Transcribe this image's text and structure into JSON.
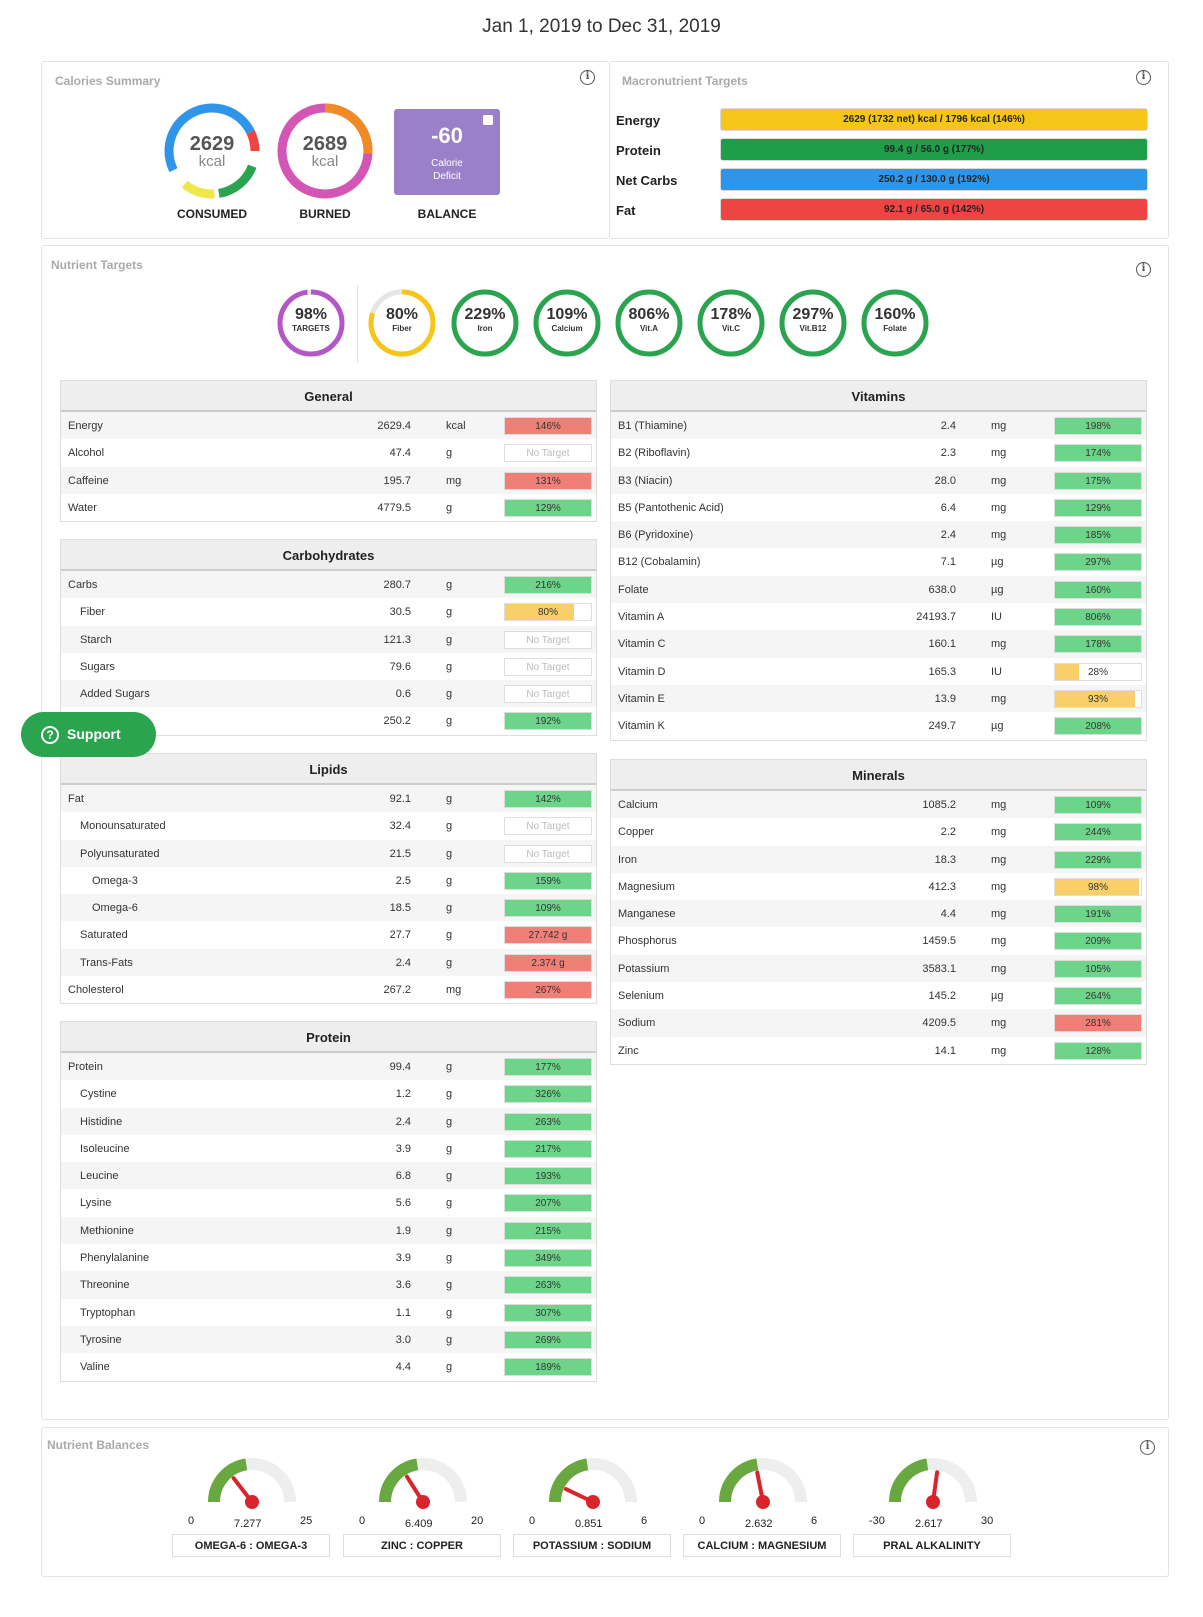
{
  "title": "Jan 1, 2019 to Dec 31, 2019",
  "calories_summary": {
    "title": "Calories Summary",
    "consumed": {
      "value": "2629",
      "unit": "kcal",
      "label": "CONSUMED"
    },
    "burned": {
      "value": "2689",
      "unit": "kcal",
      "label": "BURNED"
    },
    "balance": {
      "value": "-60",
      "sub1": "Calorie",
      "sub2": "Deficit",
      "label": "BALANCE"
    }
  },
  "macros": {
    "title": "Macronutrient Targets",
    "rows": [
      {
        "label": "Energy",
        "text": "2629 (1732 net) kcal / 1796 kcal (146%)",
        "color": "#f5c518"
      },
      {
        "label": "Protein",
        "text": "99.4 g / 56.0 g (177%)",
        "color": "#1f9e4a"
      },
      {
        "label": "Net Carbs",
        "text": "250.2 g / 130.0 g (192%)",
        "color": "#2f95e8"
      },
      {
        "label": "Fat",
        "text": "92.1 g / 65.0 g (142%)",
        "color": "#ef4444"
      }
    ]
  },
  "nutrient_targets": {
    "title": "Nutrient Targets",
    "circles": [
      {
        "pct": "98%",
        "name": "TARGETS",
        "color": "#b455c8",
        "fill": 0.98
      },
      {
        "pct": "80%",
        "name": "Fiber",
        "color": "#f5c518",
        "fill": 0.8
      },
      {
        "pct": "229%",
        "name": "Iron",
        "color": "#2aa44f",
        "fill": 1
      },
      {
        "pct": "109%",
        "name": "Calcium",
        "color": "#2aa44f",
        "fill": 1
      },
      {
        "pct": "806%",
        "name": "Vit.A",
        "color": "#2aa44f",
        "fill": 1
      },
      {
        "pct": "178%",
        "name": "Vit.C",
        "color": "#2aa44f",
        "fill": 1
      },
      {
        "pct": "297%",
        "name": "Vit.B12",
        "color": "#2aa44f",
        "fill": 1
      },
      {
        "pct": "160%",
        "name": "Folate",
        "color": "#2aa44f",
        "fill": 1
      }
    ]
  },
  "tables": {
    "general": {
      "title": "General",
      "rows": [
        [
          "Energy",
          "2629.4",
          "kcal",
          "146%",
          "r",
          1,
          0
        ],
        [
          "Alcohol",
          "47.4",
          "g",
          "No Target",
          "n",
          0,
          0
        ],
        [
          "Caffeine",
          "195.7",
          "mg",
          "131%",
          "r",
          1,
          0
        ],
        [
          "Water",
          "4779.5",
          "g",
          "129%",
          "g",
          1,
          0
        ]
      ]
    },
    "carbs": {
      "title": "Carbohydrates",
      "rows": [
        [
          "Carbs",
          "280.7",
          "g",
          "216%",
          "g",
          1,
          0
        ],
        [
          "Fiber",
          "30.5",
          "g",
          "80%",
          "y",
          0.8,
          1
        ],
        [
          "Starch",
          "121.3",
          "g",
          "No Target",
          "n",
          0,
          1
        ],
        [
          "Sugars",
          "79.6",
          "g",
          "No Target",
          "n",
          0,
          1
        ],
        [
          "Added Sugars",
          "0.6",
          "g",
          "No Target",
          "n",
          0,
          1
        ],
        [
          "",
          "250.2",
          "g",
          "192%",
          "g",
          1,
          1
        ]
      ]
    },
    "lipids": {
      "title": "Lipids",
      "rows": [
        [
          "Fat",
          "92.1",
          "g",
          "142%",
          "g",
          1,
          0
        ],
        [
          "Monounsaturated",
          "32.4",
          "g",
          "No Target",
          "n",
          0,
          1
        ],
        [
          "Polyunsaturated",
          "21.5",
          "g",
          "No Target",
          "n",
          0,
          1
        ],
        [
          "Omega-3",
          "2.5",
          "g",
          "159%",
          "g",
          1,
          2
        ],
        [
          "Omega-6",
          "18.5",
          "g",
          "109%",
          "g",
          1,
          2
        ],
        [
          "Saturated",
          "27.7",
          "g",
          "27.742 g",
          "r",
          1,
          1
        ],
        [
          "Trans-Fats",
          "2.4",
          "g",
          "2.374 g",
          "r",
          1,
          1
        ],
        [
          "Cholesterol",
          "267.2",
          "mg",
          "267%",
          "r",
          1,
          0
        ]
      ]
    },
    "protein": {
      "title": "Protein",
      "rows": [
        [
          "Protein",
          "99.4",
          "g",
          "177%",
          "g",
          1,
          0
        ],
        [
          "Cystine",
          "1.2",
          "g",
          "326%",
          "g",
          1,
          1
        ],
        [
          "Histidine",
          "2.4",
          "g",
          "263%",
          "g",
          1,
          1
        ],
        [
          "Isoleucine",
          "3.9",
          "g",
          "217%",
          "g",
          1,
          1
        ],
        [
          "Leucine",
          "6.8",
          "g",
          "193%",
          "g",
          1,
          1
        ],
        [
          "Lysine",
          "5.6",
          "g",
          "207%",
          "g",
          1,
          1
        ],
        [
          "Methionine",
          "1.9",
          "g",
          "215%",
          "g",
          1,
          1
        ],
        [
          "Phenylalanine",
          "3.9",
          "g",
          "349%",
          "g",
          1,
          1
        ],
        [
          "Threonine",
          "3.6",
          "g",
          "263%",
          "g",
          1,
          1
        ],
        [
          "Tryptophan",
          "1.1",
          "g",
          "307%",
          "g",
          1,
          1
        ],
        [
          "Tyrosine",
          "3.0",
          "g",
          "269%",
          "g",
          1,
          1
        ],
        [
          "Valine",
          "4.4",
          "g",
          "189%",
          "g",
          1,
          1
        ]
      ]
    },
    "vitamins": {
      "title": "Vitamins",
      "rows": [
        [
          "B1 (Thiamine)",
          "2.4",
          "mg",
          "198%",
          "g",
          1,
          0
        ],
        [
          "B2 (Riboflavin)",
          "2.3",
          "mg",
          "174%",
          "g",
          1,
          0
        ],
        [
          "B3 (Niacin)",
          "28.0",
          "mg",
          "175%",
          "g",
          1,
          0
        ],
        [
          "B5 (Pantothenic Acid)",
          "6.4",
          "mg",
          "129%",
          "g",
          1,
          0
        ],
        [
          "B6 (Pyridoxine)",
          "2.4",
          "mg",
          "185%",
          "g",
          1,
          0
        ],
        [
          "B12 (Cobalamin)",
          "7.1",
          "µg",
          "297%",
          "g",
          1,
          0
        ],
        [
          "Folate",
          "638.0",
          "µg",
          "160%",
          "g",
          1,
          0
        ],
        [
          "Vitamin A",
          "24193.7",
          "IU",
          "806%",
          "g",
          1,
          0
        ],
        [
          "Vitamin C",
          "160.1",
          "mg",
          "178%",
          "g",
          1,
          0
        ],
        [
          "Vitamin D",
          "165.3",
          "IU",
          "28%",
          "y",
          0.28,
          0
        ],
        [
          "Vitamin E",
          "13.9",
          "mg",
          "93%",
          "y",
          0.93,
          0
        ],
        [
          "Vitamin K",
          "249.7",
          "µg",
          "208%",
          "g",
          1,
          0
        ]
      ]
    },
    "minerals": {
      "title": "Minerals",
      "rows": [
        [
          "Calcium",
          "1085.2",
          "mg",
          "109%",
          "g",
          1,
          0
        ],
        [
          "Copper",
          "2.2",
          "mg",
          "244%",
          "g",
          1,
          0
        ],
        [
          "Iron",
          "18.3",
          "mg",
          "229%",
          "g",
          1,
          0
        ],
        [
          "Magnesium",
          "412.3",
          "mg",
          "98%",
          "y",
          0.98,
          0
        ],
        [
          "Manganese",
          "4.4",
          "mg",
          "191%",
          "g",
          1,
          0
        ],
        [
          "Phosphorus",
          "1459.5",
          "mg",
          "209%",
          "g",
          1,
          0
        ],
        [
          "Potassium",
          "3583.1",
          "mg",
          "105%",
          "g",
          1,
          0
        ],
        [
          "Selenium",
          "145.2",
          "µg",
          "264%",
          "g",
          1,
          0
        ],
        [
          "Sodium",
          "4209.5",
          "mg",
          "281%",
          "r",
          1,
          0
        ],
        [
          "Zinc",
          "14.1",
          "mg",
          "128%",
          "g",
          1,
          0
        ]
      ]
    }
  },
  "support": {
    "label": "Support"
  },
  "balances": {
    "title": "Nutrient Balances",
    "gauges": [
      {
        "label": "OMEGA-6 : OMEGA-3",
        "value": "7.277",
        "min": "0",
        "max": "25",
        "v": 7.277,
        "lo": 0,
        "hi": 25
      },
      {
        "label": "ZINC : COPPER",
        "value": "6.409",
        "min": "0",
        "max": "20",
        "v": 6.409,
        "lo": 0,
        "hi": 20
      },
      {
        "label": "POTASSIUM : SODIUM",
        "value": "0.851",
        "min": "0",
        "max": "6",
        "v": 0.851,
        "lo": 0,
        "hi": 6
      },
      {
        "label": "CALCIUM : MAGNESIUM",
        "value": "2.632",
        "min": "0",
        "max": "6",
        "v": 2.632,
        "lo": 0,
        "hi": 6
      },
      {
        "label": "PRAL ALKALINITY",
        "value": "2.617",
        "min": "-30",
        "max": "30",
        "v": 2.617,
        "lo": -30,
        "hi": 30
      }
    ]
  }
}
